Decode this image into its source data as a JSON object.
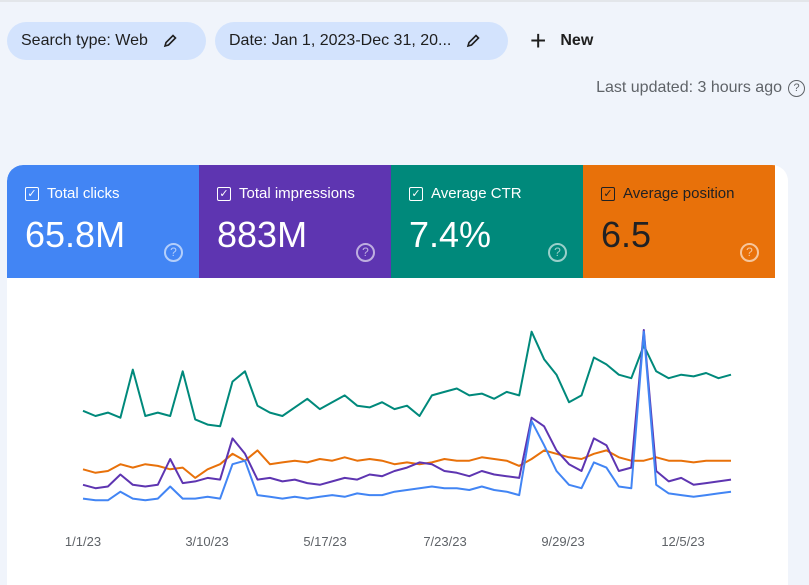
{
  "filters": [
    {
      "label": "Search type: Web",
      "icon": "pencil-icon"
    },
    {
      "label": "Date: Jan 1, 2023-Dec 31, 20...",
      "icon": "pencil-icon"
    }
  ],
  "new_button": {
    "label": "New",
    "icon": "plus-icon"
  },
  "last_updated": "Last updated: 3 hours ago",
  "metrics": [
    {
      "label": "Total clicks",
      "value": "65.8M",
      "checked": true,
      "color": "#4285f4"
    },
    {
      "label": "Total impressions",
      "value": "883M",
      "checked": true,
      "color": "#5e35b1"
    },
    {
      "label": "Average CTR",
      "value": "7.4%",
      "checked": true,
      "color": "#00897b"
    },
    {
      "label": "Average position",
      "value": "6.5",
      "checked": true,
      "color": "#e8710a"
    }
  ],
  "chart_data": {
    "type": "line",
    "x_start": "1/1/23",
    "x_end": "12/31/23",
    "x_step": "week",
    "x_ticks": [
      "1/1/23",
      "3/10/23",
      "5/17/23",
      "7/23/23",
      "9/29/23",
      "12/5/23"
    ],
    "grid": false,
    "series": [
      {
        "name": "Average CTR",
        "color": "#00897b",
        "values": [
          53,
          50,
          52,
          49,
          77,
          50,
          52,
          50,
          76,
          48,
          45,
          44,
          70,
          76,
          56,
          52,
          50,
          55,
          60,
          54,
          58,
          62,
          56,
          55,
          58,
          54,
          56,
          50,
          62,
          64,
          66,
          62,
          63,
          60,
          64,
          62,
          99,
          83,
          74,
          58,
          62,
          84,
          80,
          74,
          72,
          91,
          76,
          72,
          74,
          73,
          75,
          72,
          74
        ]
      },
      {
        "name": "Average position",
        "color": "#e8710a",
        "values": [
          19,
          17,
          18,
          22,
          20,
          22,
          21,
          19,
          20,
          14,
          19,
          22,
          28,
          24,
          30,
          22,
          23,
          24,
          23,
          25,
          24,
          26,
          24,
          25,
          24,
          22,
          23,
          22,
          23,
          25,
          24,
          24,
          26,
          25,
          24,
          21,
          25,
          30,
          28,
          26,
          25,
          28,
          30,
          26,
          24,
          24,
          26,
          24,
          24,
          23,
          24,
          24,
          24
        ]
      },
      {
        "name": "Total impressions",
        "color": "#5e35b1",
        "values": [
          10,
          8,
          9,
          16,
          10,
          9,
          10,
          25,
          11,
          12,
          14,
          13,
          37,
          28,
          13,
          14,
          12,
          13,
          11,
          10,
          12,
          14,
          13,
          16,
          15,
          18,
          20,
          23,
          22,
          18,
          17,
          15,
          18,
          16,
          15,
          14,
          49,
          44,
          30,
          22,
          18,
          37,
          33,
          18,
          20,
          100,
          18,
          12,
          14,
          10,
          11,
          12,
          13
        ]
      },
      {
        "name": "Total clicks",
        "color": "#4285f4",
        "values": [
          2,
          1,
          1,
          6,
          2,
          1,
          2,
          9,
          2,
          2,
          3,
          2,
          22,
          24,
          4,
          3,
          2,
          3,
          2,
          3,
          4,
          3,
          5,
          4,
          4,
          6,
          7,
          8,
          9,
          8,
          8,
          7,
          9,
          7,
          6,
          4,
          47,
          33,
          18,
          10,
          8,
          23,
          20,
          9,
          8,
          99,
          10,
          5,
          4,
          3,
          4,
          5,
          6
        ]
      }
    ]
  }
}
